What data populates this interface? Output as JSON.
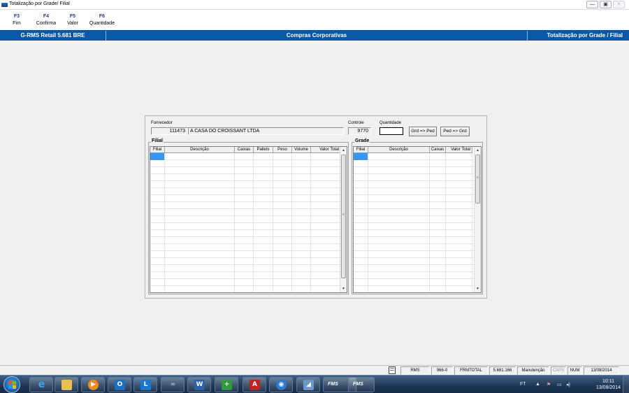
{
  "window": {
    "title": "Totalização por Grade/ Filial",
    "controls": [
      "—",
      "▣",
      "✕"
    ]
  },
  "fkeys": [
    {
      "key": "F3",
      "label": "Fim"
    },
    {
      "key": "F4",
      "label": "Confirma"
    },
    {
      "key": "F5",
      "label": "Valor"
    },
    {
      "key": "F6",
      "label": "Quantidade"
    }
  ],
  "header": {
    "version": "G-RMS Retail 5.681 BRE",
    "module": "Compras Corporativas",
    "screen": "Totalização por Grade / Filial",
    "color": "#0b57a8"
  },
  "form": {
    "fornecedor_label": "Fornecedor",
    "fornecedor_code": "111473",
    "fornecedor_name": "A CASA DO CROISSANT LTDA",
    "controle_label": "Controle",
    "controle_value": "9770",
    "quantidade_label": "Quantidade",
    "quantidade_value": "",
    "btn_grd_ped": "Grd => Ped",
    "btn_ped_grd": "Ped => Grd"
  },
  "filial_grid": {
    "title": "Filial",
    "columns": [
      "Filial",
      "Descrição",
      "Caixas",
      "Pallets",
      "Peso",
      "Volume",
      "Valor Total"
    ]
  },
  "grade_grid": {
    "title": "Grade",
    "columns": [
      "Filial",
      "Descrição",
      "Caixas",
      "Valor Total"
    ]
  },
  "statusbar": {
    "items": [
      "RMS",
      "966-0",
      "FRMTOTAL",
      "5.681.166",
      "Manutenção",
      "CAPS",
      "NUM",
      "13/08/2014"
    ]
  },
  "taskbar": {
    "apps": [
      "ie-icon",
      "explorer-icon",
      "media-player-icon",
      "outlook-icon",
      "lync-icon",
      "app-icon",
      "word-icon",
      "installer-icon",
      "acrobat-icon",
      "vpn-icon",
      "app2-icon"
    ],
    "fms_label": "FMS",
    "lang": "FT",
    "time": "10:11",
    "date": "13/08/2014"
  }
}
